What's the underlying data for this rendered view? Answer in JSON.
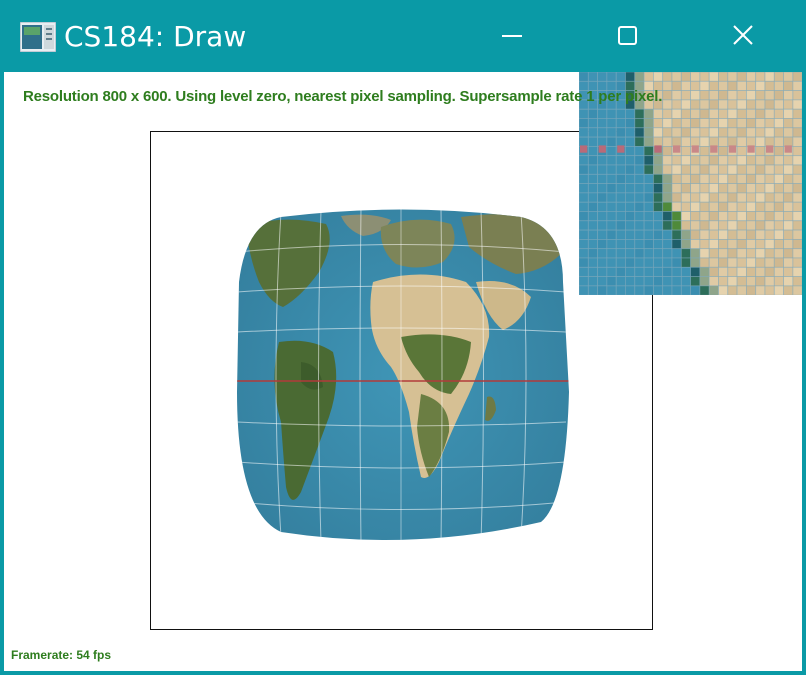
{
  "window": {
    "title": "CS184: Draw",
    "controls": {
      "minimize": "minimize-icon",
      "maximize": "maximize-icon",
      "close": "close-icon"
    }
  },
  "hud": {
    "status_text": "Resolution 800 x 600. Using level zero, nearest pixel sampling. Supersample rate 1 per pixel.",
    "framerate_text": "Framerate: 54 fps"
  },
  "colors": {
    "titlebar": "#0a9aa6",
    "hud_text": "#2e7d1e",
    "ocean": "#3a8fb2",
    "land_green": "#4d6b35",
    "land_sand": "#d8c49a"
  }
}
